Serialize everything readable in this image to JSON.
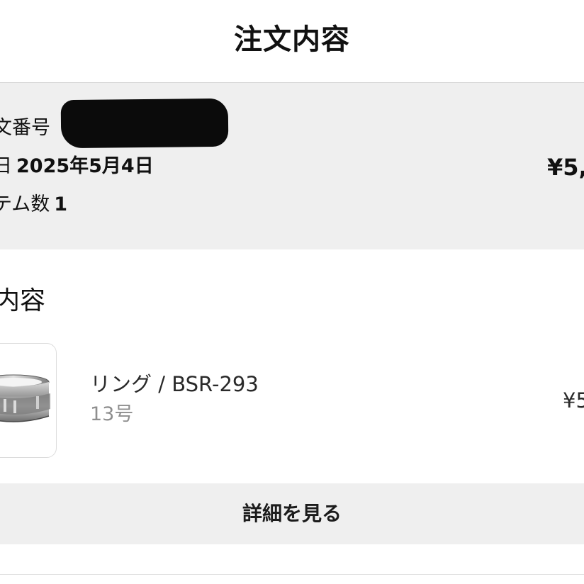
{
  "header": {
    "title": "注文内容"
  },
  "summary": {
    "order_number_label": "文番号",
    "order_date_label": "日",
    "order_date_value": "2025年5月4日",
    "item_count_label": "テム数",
    "item_count_value": "1",
    "total_price": "¥5,"
  },
  "section": {
    "title": "内容"
  },
  "item": {
    "image_icon": "ring-product-image",
    "name": "リング / BSR-293",
    "size": "13号",
    "price": "¥5"
  },
  "actions": {
    "detail_label": "詳細を見る"
  },
  "colors": {
    "background": "#ffffff",
    "panel": "#efefef",
    "text": "#111111",
    "muted_text": "#8e8e8e",
    "redaction": "#0b0b0b"
  }
}
